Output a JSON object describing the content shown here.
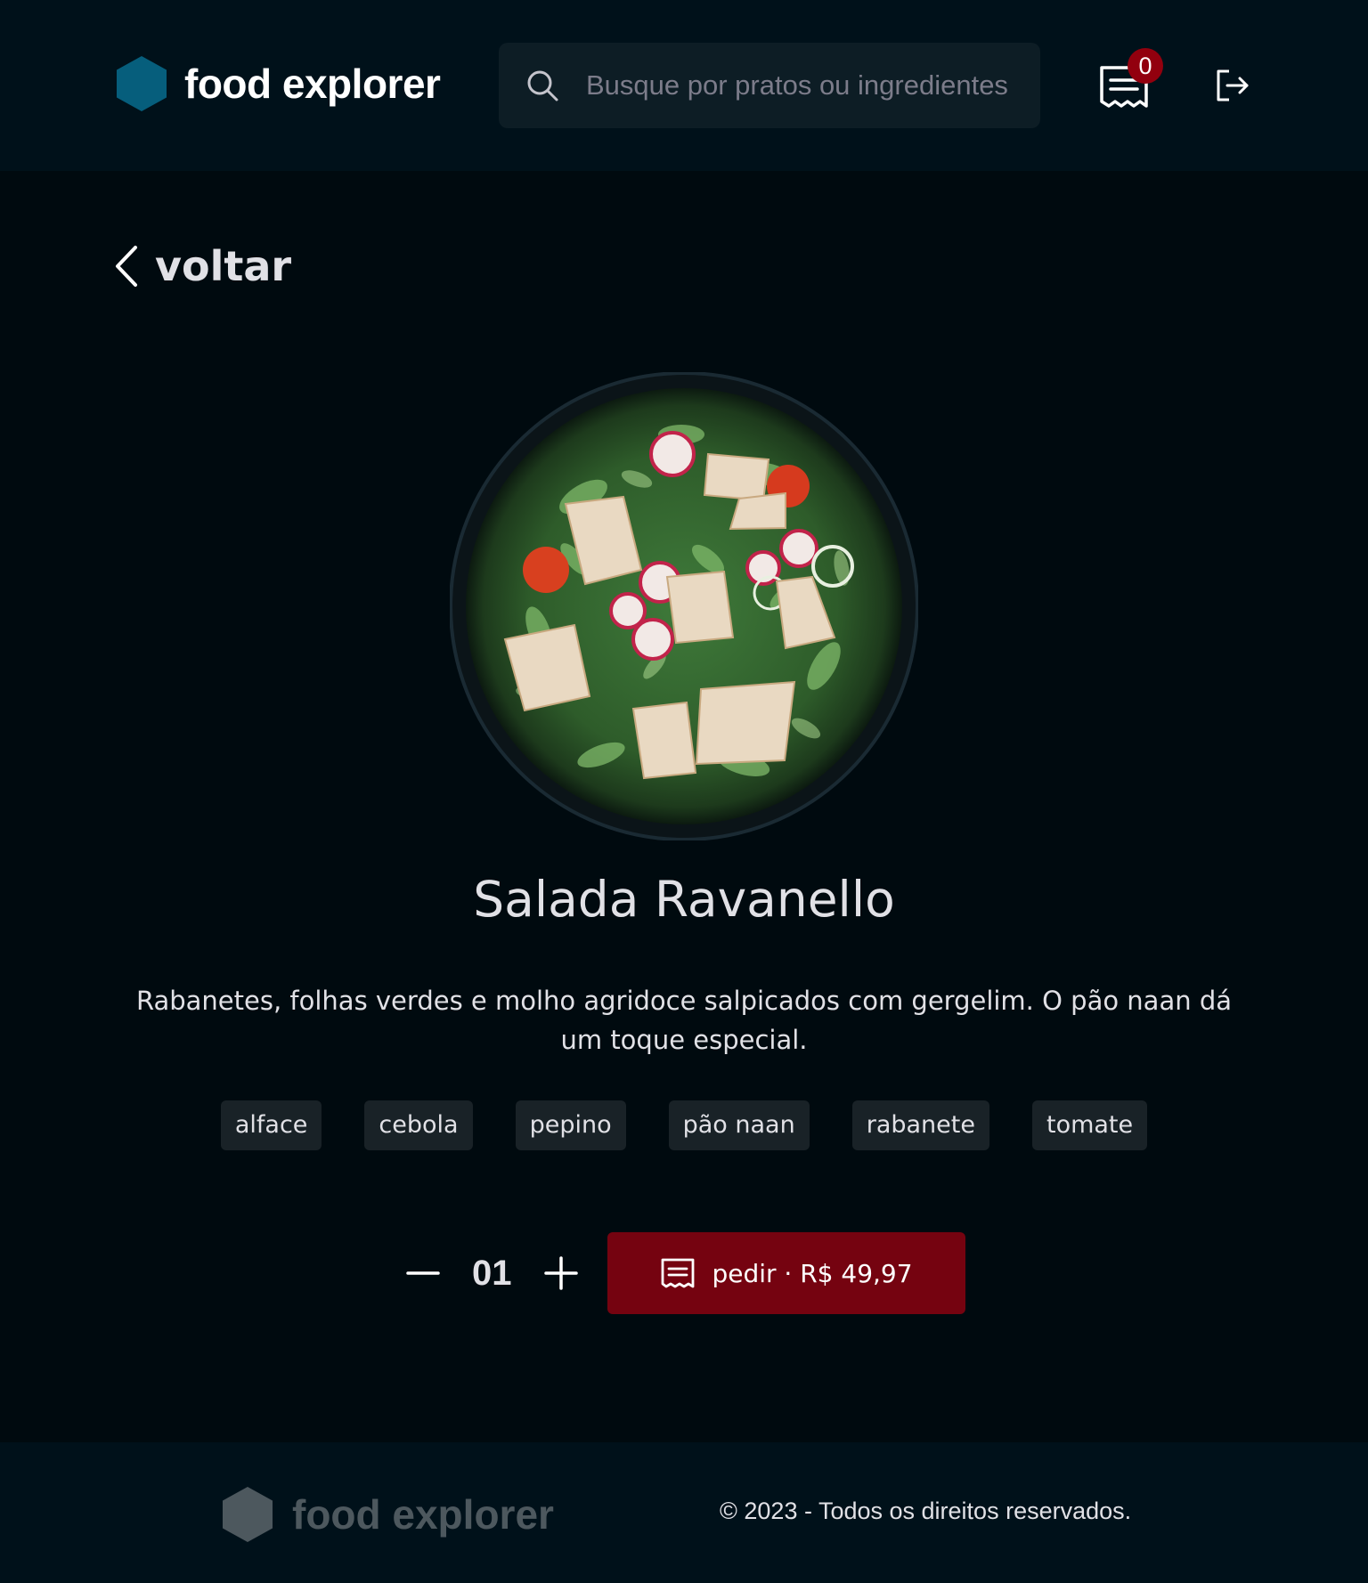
{
  "header": {
    "logo_text": "food explorer",
    "search": {
      "placeholder": "Busque por pratos ou ingredientes"
    },
    "orders": {
      "count": "0"
    },
    "logo_color": "#065e7c"
  },
  "back": {
    "label": "voltar"
  },
  "dish": {
    "title": "Salada Ravanello",
    "description": "Rabanetes, folhas verdes e molho agridoce salpicados com gergelim. O pão naan dá um toque especial.",
    "ingredients": [
      "alface",
      "cebola",
      "pepino",
      "pão naan",
      "rabanete",
      "tomate"
    ]
  },
  "order": {
    "quantity": "01",
    "button_label": "pedir · R$ 49,97",
    "button_color": "#750310"
  },
  "footer": {
    "logo_text": "food explorer",
    "copyright": "© 2023 - Todos os direitos reservados."
  },
  "colors": {
    "background": "#000a0f",
    "header_bg": "#00111a",
    "tag_bg": "#192227",
    "badge": "#92000e"
  },
  "icons": {
    "logo": "hexagon-icon",
    "search": "search-icon",
    "orders": "receipt-icon",
    "signout": "sign-out-icon",
    "back": "chevron-left-icon",
    "minus": "minus-icon",
    "plus": "plus-icon"
  }
}
